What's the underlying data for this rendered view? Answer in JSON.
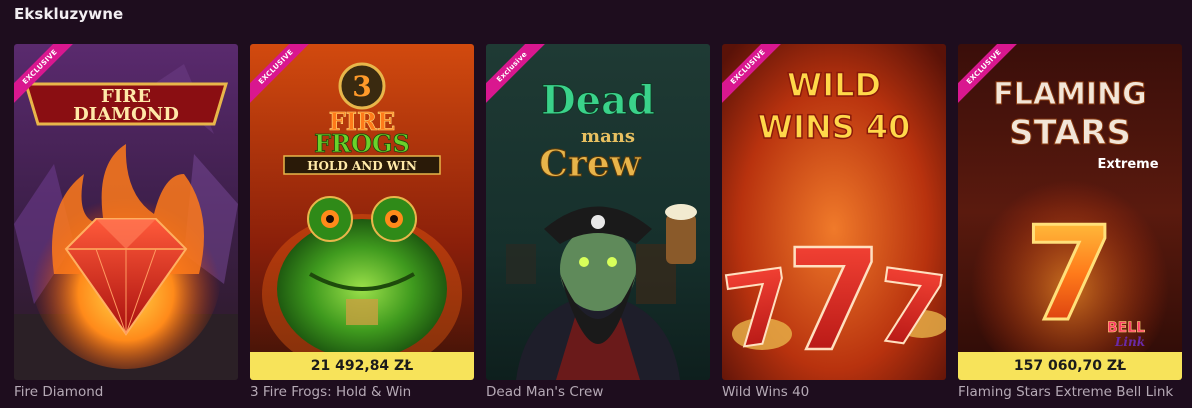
{
  "section": {
    "title": "Ekskluzywne"
  },
  "badge_label": "EXCLUSIVE",
  "colors": {
    "background": "#1e0d1e",
    "badge": "#d9178f",
    "jackpot_bar": "#f7e35a",
    "game_name_text": "#b5a9b5"
  },
  "games": [
    {
      "name": "Fire Diamond",
      "badge": "EXCLUSIVE",
      "logo_line1": "FIRE",
      "logo_line2": "DIAMOND",
      "jackpot": null
    },
    {
      "name": "3 Fire Frogs: Hold & Win",
      "badge": "EXCLUSIVE",
      "logo_line1": "3",
      "logo_line2": "FIRE",
      "logo_line3": "FROGS",
      "logo_line4": "HOLD AND WIN",
      "jackpot": "21 492,84 ZŁ"
    },
    {
      "name": "Dead Man's Crew",
      "badge": "Exclusive",
      "logo_line1": "Dead",
      "logo_line2": "mans",
      "logo_line3": "Crew",
      "jackpot": null
    },
    {
      "name": "Wild Wins 40",
      "badge": "EXCLUSIVE",
      "logo_line1": "WILD",
      "logo_line2": "WINS 40",
      "jackpot": null
    },
    {
      "name": "Flaming Stars Extreme Bell Link",
      "badge": "EXCLUSIVE",
      "logo_line1": "FLAMING",
      "logo_line2": "STARS",
      "logo_line3": "Extreme",
      "logo_line4": "BELL",
      "logo_line5": "Link",
      "jackpot": "157 060,70 ZŁ"
    }
  ]
}
